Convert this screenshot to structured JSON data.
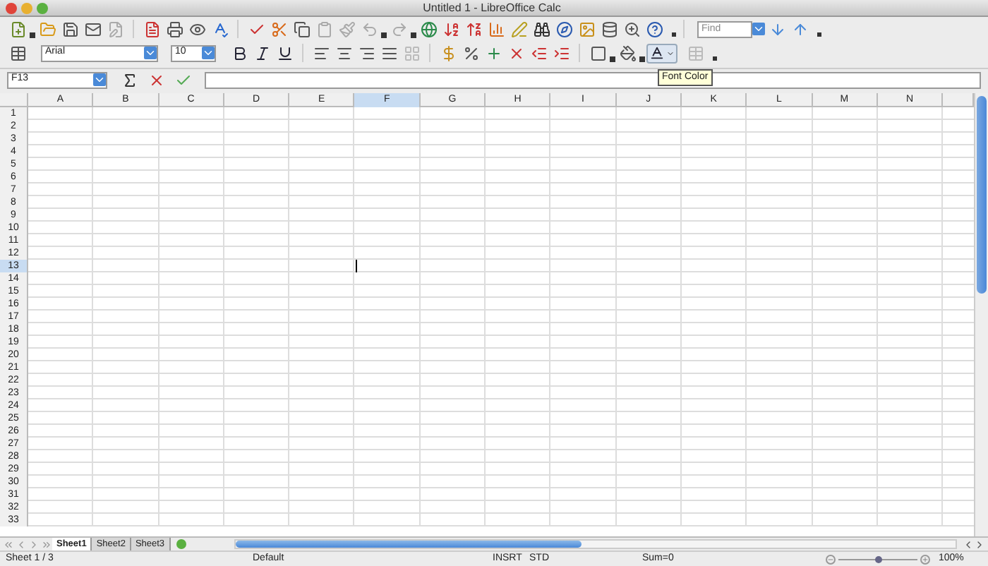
{
  "window": {
    "title": "Untitled 1 - LibreOffice Calc"
  },
  "standard_toolbar": {
    "find": {
      "placeholder": "Find"
    }
  },
  "formatting_toolbar": {
    "font_name": "Arial",
    "font_size": "10",
    "tooltip": "Font Color"
  },
  "formula_bar": {
    "cell_reference": "F13"
  },
  "columns": [
    {
      "label": "A",
      "selected": false
    },
    {
      "label": "B",
      "selected": false
    },
    {
      "label": "C",
      "selected": false
    },
    {
      "label": "D",
      "selected": false
    },
    {
      "label": "E",
      "selected": false
    },
    {
      "label": "F",
      "selected": true
    },
    {
      "label": "G",
      "selected": false
    },
    {
      "label": "H",
      "selected": false
    },
    {
      "label": "I",
      "selected": false
    },
    {
      "label": "J",
      "selected": false
    },
    {
      "label": "K",
      "selected": false
    },
    {
      "label": "L",
      "selected": false
    },
    {
      "label": "M",
      "selected": false
    },
    {
      "label": "N",
      "selected": false
    }
  ],
  "rows": [
    {
      "label": "1",
      "selected": false
    },
    {
      "label": "2",
      "selected": false
    },
    {
      "label": "3",
      "selected": false
    },
    {
      "label": "4",
      "selected": false
    },
    {
      "label": "5",
      "selected": false
    },
    {
      "label": "6",
      "selected": false
    },
    {
      "label": "7",
      "selected": false
    },
    {
      "label": "8",
      "selected": false
    },
    {
      "label": "9",
      "selected": false
    },
    {
      "label": "10",
      "selected": false
    },
    {
      "label": "11",
      "selected": false
    },
    {
      "label": "12",
      "selected": false
    },
    {
      "label": "13",
      "selected": true
    },
    {
      "label": "14",
      "selected": false
    },
    {
      "label": "15",
      "selected": false
    },
    {
      "label": "16",
      "selected": false
    },
    {
      "label": "17",
      "selected": false
    },
    {
      "label": "18",
      "selected": false
    },
    {
      "label": "19",
      "selected": false
    },
    {
      "label": "20",
      "selected": false
    },
    {
      "label": "21",
      "selected": false
    },
    {
      "label": "22",
      "selected": false
    },
    {
      "label": "23",
      "selected": false
    },
    {
      "label": "24",
      "selected": false
    },
    {
      "label": "25",
      "selected": false
    },
    {
      "label": "26",
      "selected": false
    },
    {
      "label": "27",
      "selected": false
    },
    {
      "label": "28",
      "selected": false
    },
    {
      "label": "29",
      "selected": false
    },
    {
      "label": "30",
      "selected": false
    },
    {
      "label": "31",
      "selected": false
    },
    {
      "label": "32",
      "selected": false
    },
    {
      "label": "33",
      "selected": false
    }
  ],
  "sheet_tabs": [
    {
      "label": "Sheet1",
      "selected": true
    },
    {
      "label": "Sheet2",
      "selected": false
    },
    {
      "label": "Sheet3",
      "selected": false
    }
  ],
  "status_bar": {
    "sheet": "Sheet 1 / 3",
    "page_style": "Default",
    "insert_mode": "INSRT",
    "selection_mode": "STD",
    "sum": "Sum=0",
    "zoom": {
      "level": 0.5,
      "reading": "100%"
    }
  }
}
